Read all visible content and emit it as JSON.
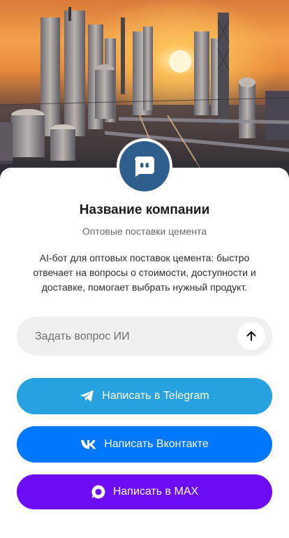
{
  "company": {
    "name": "Название компании",
    "subtitle": "Оптовые поставки цемента",
    "description": "AI-бот для оптовых поставок цемента: быстро отвечает на вопросы о стоимости, доступности и доставке, помогает выбрать нужный продукт."
  },
  "ask": {
    "placeholder": "Задать вопрос ИИ",
    "value": ""
  },
  "buttons": {
    "telegram": "Написать в Telegram",
    "vk": "Написать Вконтакте",
    "max": "Написать в MAX"
  },
  "icons": {
    "avatar": "chat-bot-icon",
    "send": "arrow-up-icon",
    "telegram": "telegram-icon",
    "vk": "vk-icon",
    "max": "max-icon"
  },
  "colors": {
    "avatar": "#2f5f8c",
    "telegram": "#28a1e0",
    "vk": "#0077ff",
    "max": "#6c0cf5",
    "ask_field": "#f0f0f2"
  }
}
